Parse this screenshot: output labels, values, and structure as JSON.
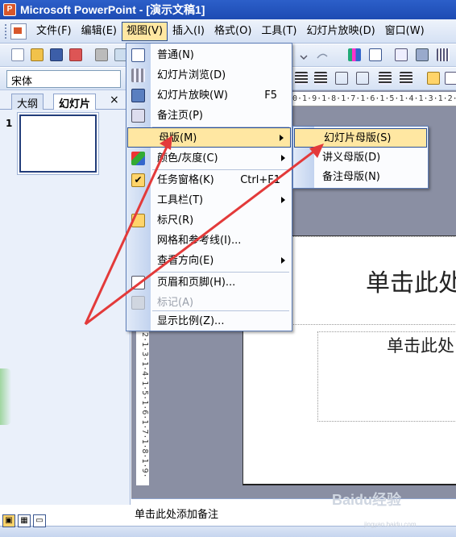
{
  "window": {
    "title": "Microsoft PowerPoint - [演示文稿1]"
  },
  "menubar": {
    "items": [
      {
        "label": "文件(F)"
      },
      {
        "label": "编辑(E)"
      },
      {
        "label": "视图(V)"
      },
      {
        "label": "插入(I)"
      },
      {
        "label": "格式(O)"
      },
      {
        "label": "工具(T)"
      },
      {
        "label": "幻灯片放映(D)"
      },
      {
        "label": "窗口(W)"
      }
    ]
  },
  "formatting": {
    "font_name": "宋体"
  },
  "left_panel": {
    "tabs": [
      {
        "label": "大纲"
      },
      {
        "label": "幻灯片"
      }
    ],
    "close_glyph": "×",
    "slide_number": "1"
  },
  "view_menu": {
    "items": [
      {
        "label": "普通(N)",
        "shortcut": ""
      },
      {
        "label": "幻灯片浏览(D)",
        "shortcut": ""
      },
      {
        "label": "幻灯片放映(W)",
        "shortcut": "F5"
      },
      {
        "label": "备注页(P)",
        "shortcut": ""
      },
      {
        "label": "母版(M)",
        "shortcut": ""
      },
      {
        "label": "颜色/灰度(C)",
        "shortcut": ""
      },
      {
        "label": "任务窗格(K)",
        "shortcut": "Ctrl+F1"
      },
      {
        "label": "工具栏(T)",
        "shortcut": ""
      },
      {
        "label": "标尺(R)",
        "shortcut": ""
      },
      {
        "label": "网格和参考线(I)...",
        "shortcut": ""
      },
      {
        "label": "查看方向(E)",
        "shortcut": ""
      },
      {
        "label": "页眉和页脚(H)...",
        "shortcut": ""
      },
      {
        "label": "标记(A)",
        "shortcut": ""
      },
      {
        "label": "显示比例(Z)...",
        "shortcut": ""
      }
    ]
  },
  "master_submenu": {
    "items": [
      {
        "label": "幻灯片母版(S)"
      },
      {
        "label": "讲义母版(D)"
      },
      {
        "label": "备注母版(N)"
      }
    ]
  },
  "ruler": {
    "horizontal": "0·1·9·1·8·1·7·1·6·1·5·1·4·1·3·1·2·",
    "vertical": "2·1·3·1·4·1·5·1·6·1·7·1·8·1·9·"
  },
  "slide": {
    "title_text": "单击此处",
    "subtitle_text": "单击此处"
  },
  "notes": {
    "placeholder": "单击此处添加备注"
  },
  "watermark": {
    "text": "Baidu经验",
    "url_text": "jingyan.baidu.com"
  },
  "colors": {
    "highlight": "#ffe7a2",
    "title_bar": "#2c5fc9",
    "arrow": "#e33a3a"
  }
}
